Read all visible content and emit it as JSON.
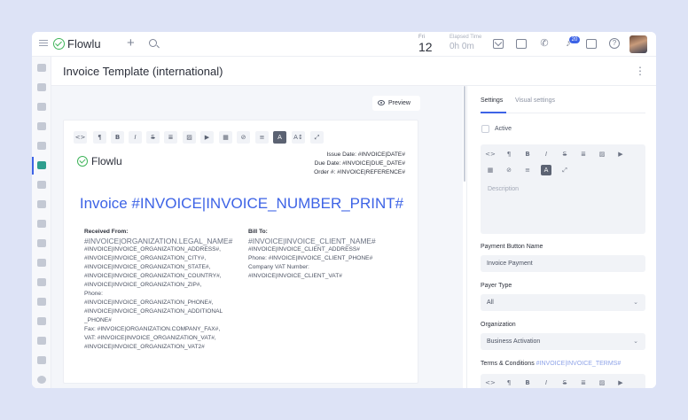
{
  "app": {
    "name": "Flowlu"
  },
  "topbar": {
    "date_dow": "Fri",
    "date_day": "12",
    "timer_label": "Elapsed Time",
    "timer_value": "0h 0m",
    "notifications_count": "20"
  },
  "page": {
    "title": "Invoice Template (international)"
  },
  "editor": {
    "preview_label": "Preview",
    "toolbar": [
      "<>",
      "¶",
      "B",
      "I",
      "S",
      "≣",
      "▨",
      "▶",
      "▦",
      "⊘",
      "≡",
      "A",
      "A↕",
      "⤢"
    ],
    "logo_text": "Flowlu",
    "issue_date": "Issue Date: #INVOICE|DATE#",
    "due_date": "Due Date: #INVOICE|DUE_DATE#",
    "order_no": "Order #: #INVOICE|REFERENCE#",
    "invoice_title": "Invoice #INVOICE|INVOICE_NUMBER_PRINT#",
    "received_from": {
      "heading": "Received From:",
      "name": "#INVOICE|ORGANIZATION.LEGAL_NAME#",
      "lines": [
        "#INVOICE|INVOICE_ORGANIZATION_ADDRESS#,",
        "#INVOICE|INVOICE_ORGANIZATION_CITY#,",
        "#INVOICE|INVOICE_ORGANIZATION_STATE#,",
        "#INVOICE|INVOICE_ORGANIZATION_COUNTRY#,",
        "#INVOICE|INVOICE_ORGANIZATION_ZIP#,",
        "Phone:",
        "#INVOICE|INVOICE_ORGANIZATION_PHONE#,",
        "#INVOICE|INVOICE_ORGANIZATION_ADDITIONAL",
        "_PHONE#",
        "Fax: #INVOICE|ORGANIZATION.COMPANY_FAX#,",
        "VAT: #INVOICE|INVOICE_ORGANIZATION_VAT#,",
        "#INVOICE|INVOICE_ORGANIZATION_VAT2#"
      ]
    },
    "bill_to": {
      "heading": "Bill To:",
      "name": "#INVOICE|INVOICE_CLIENT_NAME#",
      "lines": [
        "#INVOICE|INVOICE_CLIENT_ADDRESS#",
        "Phone: #INVOICE|INVOICE_CLIENT_PHONE#",
        "Company VAT Number:",
        "#INVOICE|INVOICE_CLIENT_VAT#"
      ]
    }
  },
  "settings": {
    "tabs": [
      "Settings",
      "Visual settings"
    ],
    "active_label": "Active",
    "toolbar": [
      "<>",
      "¶",
      "B",
      "I",
      "S",
      "≣",
      "▨",
      "▶",
      "▦",
      "⊘",
      "≡",
      "A",
      "⤢"
    ],
    "description_placeholder": "Description",
    "payment_button": {
      "label": "Payment Button Name",
      "value": "Invoice Payment"
    },
    "payer_type": {
      "label": "Payer Type",
      "value": "All"
    },
    "organization": {
      "label": "Organization",
      "value": "Business Activation"
    },
    "terms": {
      "label": "Terms & Conditions",
      "tag": "#INVOICE|INVOICE_TERMS#"
    },
    "terms_toolbar": [
      "<>",
      "¶",
      "B",
      "I",
      "S",
      "≣",
      "▨",
      "▶"
    ]
  },
  "colors": {
    "accent": "#3d63e6",
    "brand_green": "#3fb45a",
    "background": "#dde3f6"
  }
}
